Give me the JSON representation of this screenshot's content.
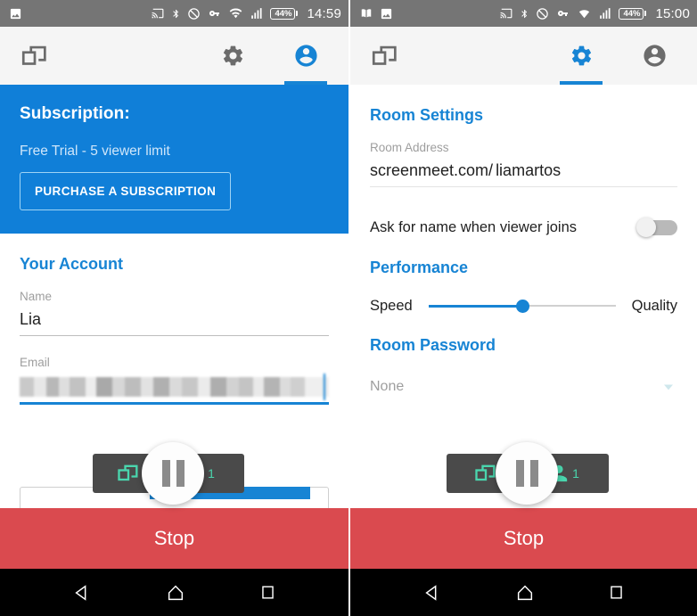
{
  "colors": {
    "accent_blue": "#1784d4",
    "subscription_blue": "#107fd8",
    "stop_red": "#da4a4f",
    "statusbar_gray": "#757575",
    "float_dark": "#4a4a4a",
    "teal": "#4ad6ae"
  },
  "left": {
    "statusbar": {
      "icons_left": [
        "image-icon"
      ],
      "icons_right": [
        "cast-icon",
        "bluetooth-icon",
        "do-not-disturb-icon",
        "vpn-key-icon",
        "wifi-icon",
        "signal-icon"
      ],
      "battery_percent": "44%",
      "time": "14:59"
    },
    "appbar": {
      "brand_icon": "screen-share-icon",
      "tabs": [
        {
          "icon": "gear-icon",
          "name": "settings",
          "active": false
        },
        {
          "icon": "account-circle-icon",
          "name": "account",
          "active": true
        }
      ]
    },
    "subscription": {
      "title": "Subscription:",
      "status": "Free Trial - 5 viewer limit",
      "button_label": "PURCHASE A SUBSCRIPTION"
    },
    "account": {
      "section_title": "Your Account",
      "name_label": "Name",
      "name_value": "Lia",
      "email_label": "Email",
      "email_value": ""
    },
    "float_control": {
      "share_icon": "screen-share-icon",
      "pause_icon": "pause-icon",
      "viewer_icon": "person-icon",
      "viewer_count": "1"
    },
    "stop_label": "Stop",
    "navbar": [
      "back-icon",
      "home-icon",
      "recents-icon"
    ]
  },
  "right": {
    "statusbar": {
      "icons_left": [
        "book-icon",
        "image-icon"
      ],
      "icons_right": [
        "cast-icon",
        "bluetooth-icon",
        "do-not-disturb-icon",
        "vpn-key-icon",
        "wifi-icon",
        "signal-icon"
      ],
      "battery_percent": "44%",
      "time": "15:00"
    },
    "appbar": {
      "brand_icon": "screen-share-icon",
      "tabs": [
        {
          "icon": "gear-icon",
          "name": "settings",
          "active": true
        },
        {
          "icon": "account-circle-icon",
          "name": "account",
          "active": false
        }
      ]
    },
    "room_settings": {
      "section_title": "Room Settings",
      "address_label": "Room Address",
      "address_prefix": "screenmeet.com/",
      "address_room": "liamartos",
      "ask_name_label": "Ask for name when viewer joins",
      "ask_name_on": false
    },
    "performance": {
      "section_title": "Performance",
      "left_label": "Speed",
      "right_label": "Quality",
      "value_percent": 50
    },
    "room_password": {
      "section_title": "Room Password",
      "value": "None",
      "chevron_icon": "chevron-down-icon"
    },
    "float_control": {
      "share_icon": "screen-share-icon",
      "pause_icon": "pause-icon",
      "viewer_icon": "person-icon",
      "viewer_count": "1"
    },
    "stop_label": "Stop",
    "navbar": [
      "back-icon",
      "home-icon",
      "recents-icon"
    ]
  }
}
